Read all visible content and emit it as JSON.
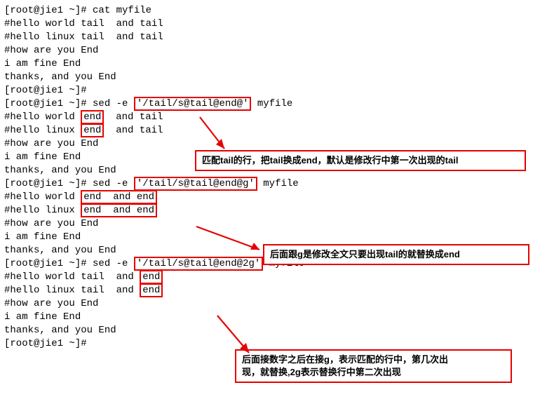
{
  "term": {
    "l1": "[root@jie1 ~]# cat myfile",
    "l2": "#hello world tail  and tail",
    "l3": "#hello linux tail  and tail",
    "l4": "#how are you End",
    "l5": "i am fine End",
    "l6": "thanks, and you End",
    "l7": "[root@jie1 ~]#",
    "sed1_prefix": "[root@jie1 ~]# sed -e ",
    "sed1_cmd": "'/tail/s@tail@end@'",
    "sed1_suffix": " myfile",
    "o1a_pre": "#hello world ",
    "o1a_hl": "end",
    "o1a_post": "  and tail",
    "o1b_pre": "#hello linux ",
    "o1b_hl": "end",
    "o1b_post": "  and tail",
    "o1c": "#how are you End",
    "o1d": "i am fine End",
    "o1e": "thanks, and you End",
    "sed2_prefix": "[root@jie1 ~]# sed -e ",
    "sed2_cmd": "'/tail/s@tail@end@g'",
    "sed2_suffix": " myfile",
    "o2a_pre": "#hello world ",
    "o2a_hl": "end  and end",
    "o2b_pre": "#hello linux ",
    "o2b_hl": "end  and end",
    "o2c": "#how are you End",
    "o2d": "i am fine End",
    "o2e": "thanks, and you End",
    "sed3_prefix": "[root@jie1 ~]# sed -e ",
    "sed3_cmd": "'/tail/s@tail@end@2g'",
    "sed3_suffix": " myfile",
    "o3a_pre": "#hello world tail  and ",
    "o3a_hl": "end",
    "o3b_pre": "#hello linux tail  and ",
    "o3b_hl": "end",
    "o3c": "#how are you End",
    "o3d": "i am fine End",
    "o3e": "thanks, and you End",
    "l_end": "[root@jie1 ~]#"
  },
  "annot": {
    "box1": "匹配tail的行，把tail换成end，默认是修改行中第一次出现的tail",
    "box2": "后面跟g是修改全文只要出现tail的就替换成end",
    "box3_l1": "后面接数字之后在接g，表示匹配的行中，第几次出",
    "box3_l2": "现，就替换,2g表示替换行中第二次出现"
  }
}
